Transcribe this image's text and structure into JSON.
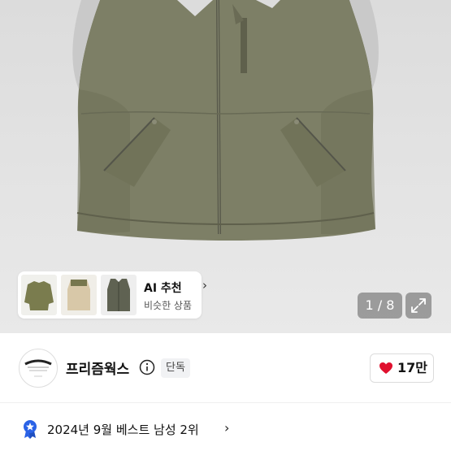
{
  "gallery": {
    "counter": "1 / 8",
    "expand_icon": "expand-icon"
  },
  "ai_recommend": {
    "title": "AI 추천",
    "subtitle": "비슷한 상품",
    "chevron": "›",
    "thumbnails": [
      "jacket-thumbnail",
      "fleece-vest-thumbnail",
      "vest-thumbnail"
    ]
  },
  "store": {
    "name": "프리즘웍스",
    "badge": "단독",
    "likes": "17만",
    "like_color": "#e0102e"
  },
  "ranking": {
    "text": "2024년 9월 베스트 남성 2위",
    "chevron": "›",
    "icon_color": "#2a62e6"
  }
}
